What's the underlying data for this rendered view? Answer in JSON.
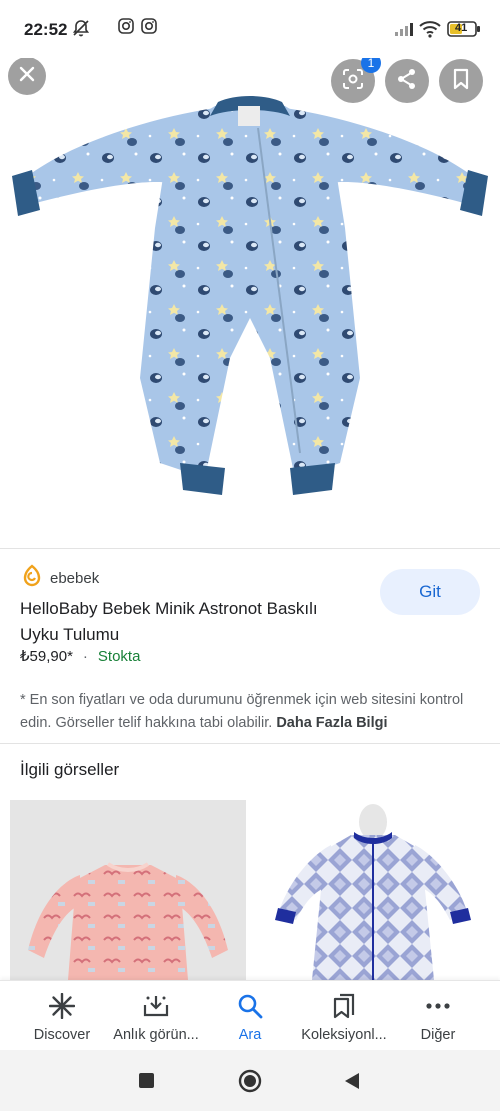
{
  "status_bar": {
    "time": "22:52",
    "battery": "41"
  },
  "hero": {
    "badge_count": "1",
    "icons": [
      "close-icon",
      "lens-icon",
      "share-icon",
      "bookmark-icon"
    ]
  },
  "product": {
    "source": "ebebek",
    "title": "HelloBaby Bebek Minik Astronot Baskılı Uyku Tulumu",
    "price": "₺59,90*",
    "separator": "·",
    "stock": "Stokta",
    "action_label": "Git"
  },
  "disclaimer": {
    "text": "* En son fiyatları ve oda durumunu öğrenmek için web sitesini kontrol edin. Görseller telif hakkına tabi olabilir.",
    "more_link": "Daha Fazla Bilgi"
  },
  "related": {
    "heading": "İlgili görseller"
  },
  "bottom_nav": {
    "items": [
      {
        "label": "Discover",
        "icon": "asterisk-icon"
      },
      {
        "label": "Anlık görün...",
        "icon": "snapshot-icon"
      },
      {
        "label": "Ara",
        "icon": "search-icon"
      },
      {
        "label": "Koleksiyonl...",
        "icon": "collections-icon"
      },
      {
        "label": "Diğer",
        "icon": "more-icon"
      }
    ],
    "active_index": 2
  },
  "colors": {
    "accent": "#1a73e8",
    "stock_green": "#188038",
    "button_bg": "#e8f0fe",
    "garment_blue": "#a9c6e8",
    "cuff_navy": "#2f5c87"
  }
}
